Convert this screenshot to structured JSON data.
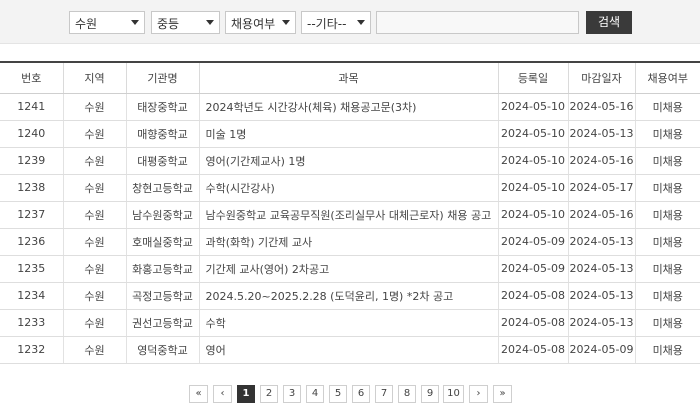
{
  "filters": {
    "region": "수원",
    "school_level": "중등",
    "hire_status": "채용여부",
    "other": "--기타--",
    "keyword": "",
    "search_label": "검색"
  },
  "table": {
    "headers": [
      "번호",
      "지역",
      "기관명",
      "과목",
      "등록일",
      "마감일자",
      "채용여부"
    ],
    "rows": [
      [
        "1241",
        "수원",
        "태장중학교",
        "2024학년도 시간강사(체육) 채용공고문(3차)",
        "2024-05-10",
        "2024-05-16",
        "미채용"
      ],
      [
        "1240",
        "수원",
        "매향중학교",
        "미술 1명",
        "2024-05-10",
        "2024-05-13",
        "미채용"
      ],
      [
        "1239",
        "수원",
        "대평중학교",
        "영어(기간제교사) 1명",
        "2024-05-10",
        "2024-05-16",
        "미채용"
      ],
      [
        "1238",
        "수원",
        "창현고등학교",
        "수학(시간강사)",
        "2024-05-10",
        "2024-05-17",
        "미채용"
      ],
      [
        "1237",
        "수원",
        "남수원중학교",
        "남수원중학교 교육공무직원(조리실무사 대체근로자) 채용 공고",
        "2024-05-10",
        "2024-05-16",
        "미채용"
      ],
      [
        "1236",
        "수원",
        "호매실중학교",
        "과학(화학) 기간제 교사",
        "2024-05-09",
        "2024-05-13",
        "미채용"
      ],
      [
        "1235",
        "수원",
        "화홍고등학교",
        "기간제 교사(영어) 2차공고",
        "2024-05-09",
        "2024-05-13",
        "미채용"
      ],
      [
        "1234",
        "수원",
        "곡정고등학교",
        "2024.5.20~2025.2.28 (도덕윤리, 1명) *2차 공고",
        "2024-05-08",
        "2024-05-13",
        "미채용"
      ],
      [
        "1233",
        "수원",
        "권선고등학교",
        "수학",
        "2024-05-08",
        "2024-05-13",
        "미채용"
      ],
      [
        "1232",
        "수원",
        "영덕중학교",
        "영어",
        "2024-05-08",
        "2024-05-09",
        "미채용"
      ]
    ]
  },
  "pagination": {
    "first": "«",
    "prev": "‹",
    "pages": [
      "1",
      "2",
      "3",
      "4",
      "5",
      "6",
      "7",
      "8",
      "9",
      "10"
    ],
    "current": "1",
    "next": "›",
    "last": "»"
  }
}
